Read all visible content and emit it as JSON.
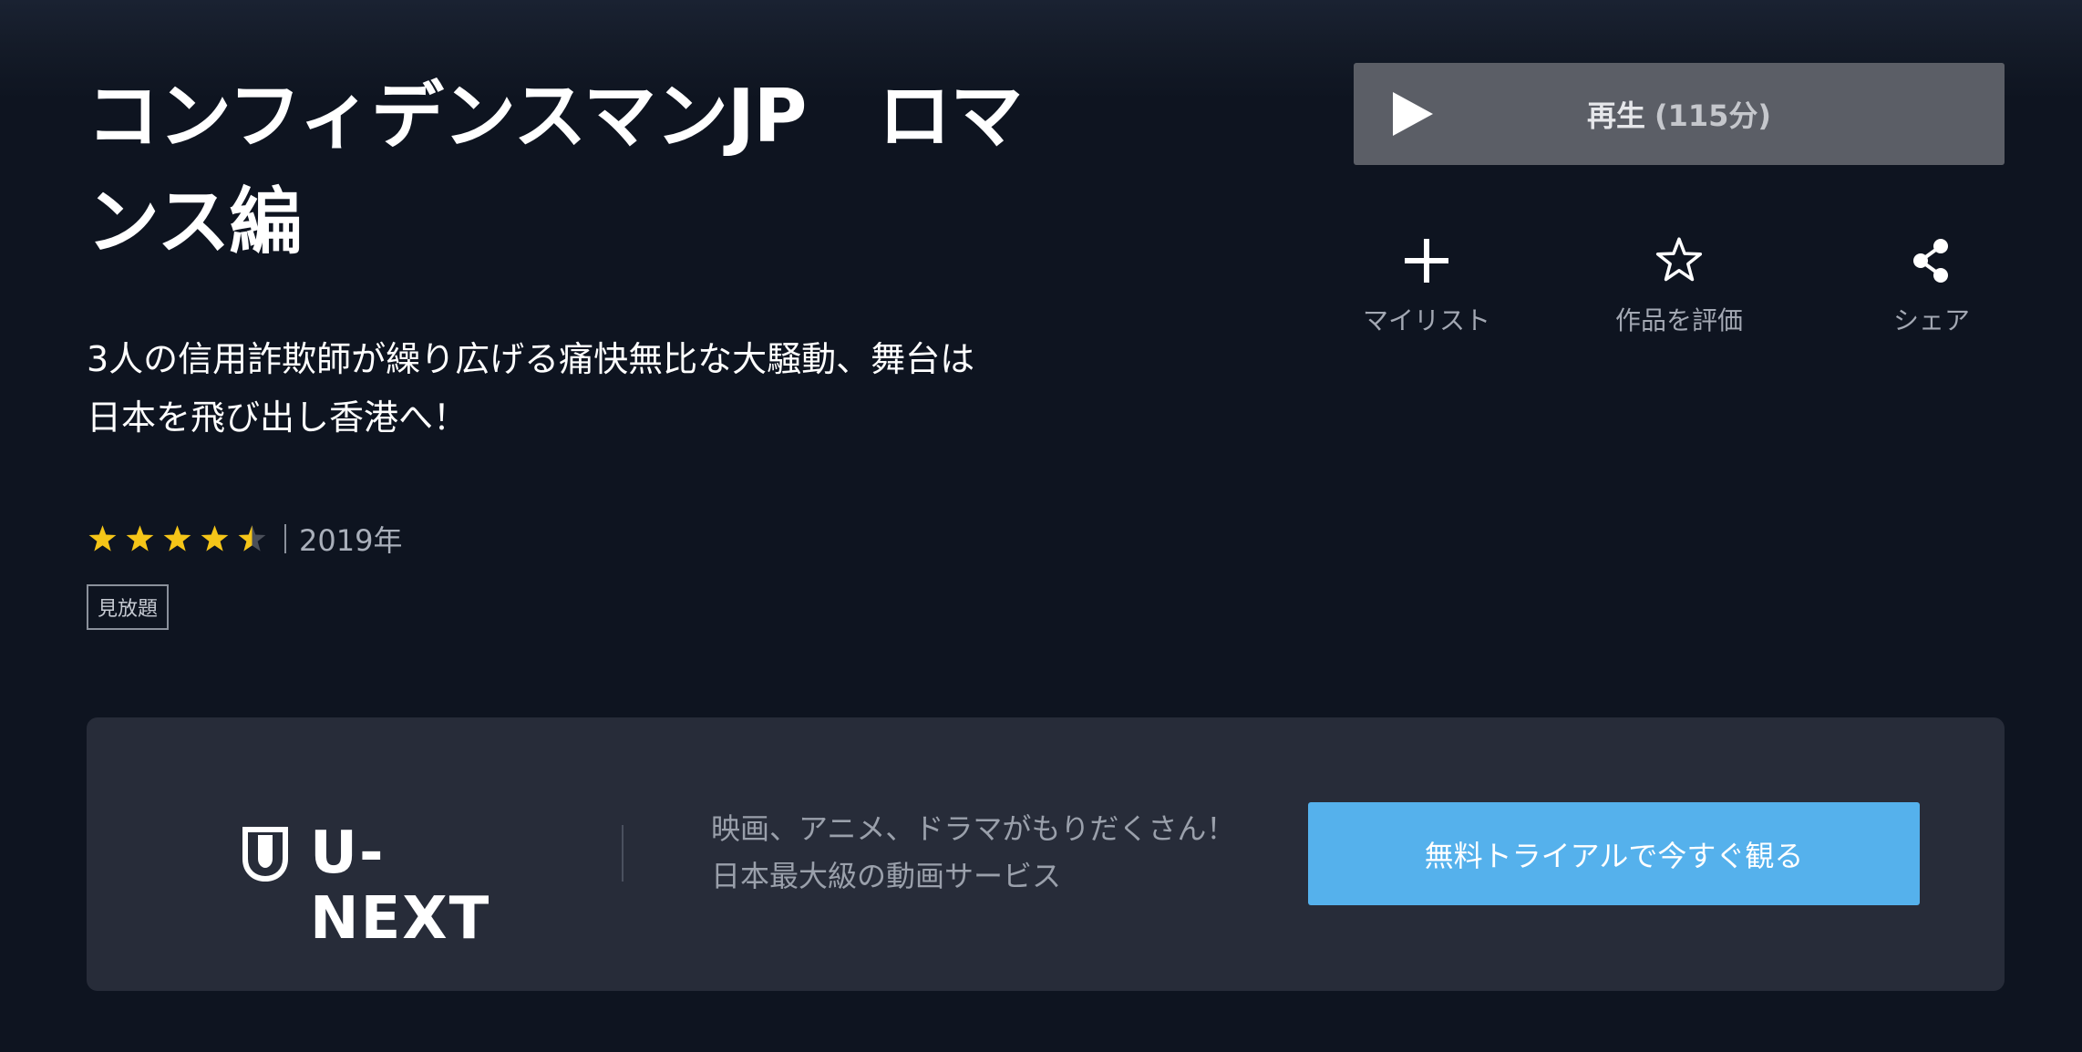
{
  "title": {
    "line1": "コンフィデンスマンJP　ロマ",
    "line2": "ンス編"
  },
  "description": {
    "line1": "3人の信用詐欺師が繰り広げる痛快無比な大騒動、舞台は",
    "line2": "日本を飛び出し香港へ！"
  },
  "meta": {
    "rating": 4.5,
    "rating_max": 5,
    "separator": "|",
    "year": "2019年",
    "badge": "見放題"
  },
  "player": {
    "play_label": "再生",
    "duration": "(115分)"
  },
  "actions": {
    "mylist_label": "マイリスト",
    "rate_label": "作品を評価",
    "share_label": "シェア"
  },
  "promo": {
    "logo_text": "U-NEXT",
    "text_line1": "映画、アニメ、ドラマがもりだくさん！",
    "text_line2": "日本最大級の動画サービス",
    "cta_label": "無料トライアルで今すぐ観る"
  },
  "colors": {
    "background": "#0e1420",
    "star": "#f5c518",
    "play_button": "#5b5e66",
    "promo_panel": "#272c39",
    "cta": "#55b1ec"
  },
  "icons": {
    "play": "play-icon",
    "mylist": "plus-icon",
    "rate": "star-outline-icon",
    "share": "share-icon",
    "logo": "shield-icon"
  }
}
